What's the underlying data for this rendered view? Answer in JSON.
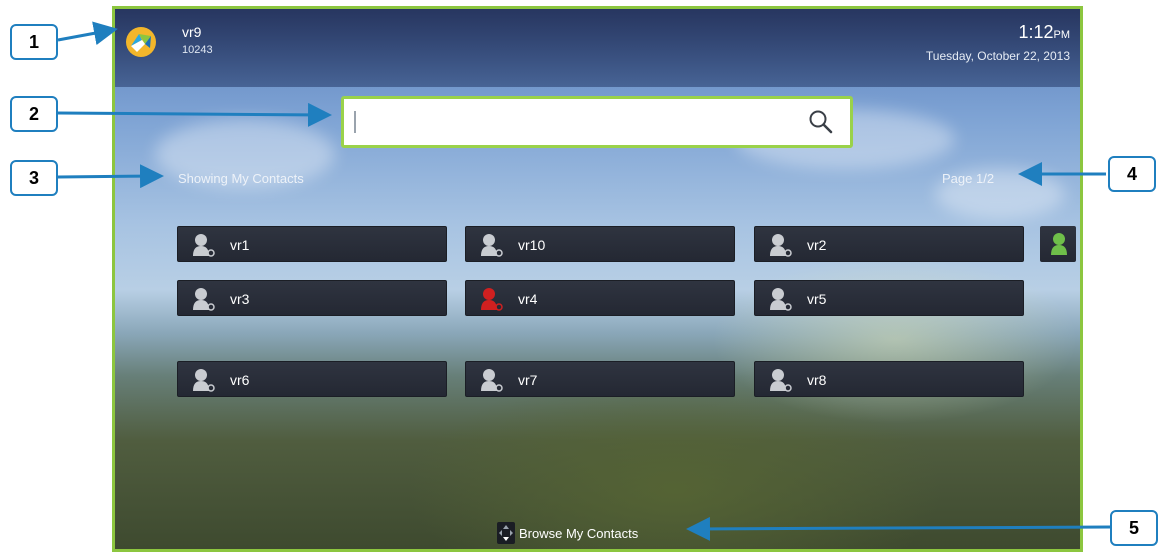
{
  "user": {
    "name": "vr9",
    "number": "10243"
  },
  "clock": {
    "time": "1:12",
    "ampm": "PM",
    "date": "Tuesday, October 22, 2013"
  },
  "search": {
    "value": "",
    "placeholder": ""
  },
  "showing_label": "Showing My Contacts",
  "page_label": "Page 1/2",
  "contacts": [
    {
      "name": "vr1",
      "status": "available"
    },
    {
      "name": "vr10",
      "status": "available"
    },
    {
      "name": "vr2",
      "status": "available"
    },
    {
      "name": "vr3",
      "status": "available"
    },
    {
      "name": "vr4",
      "status": "busy"
    },
    {
      "name": "vr5",
      "status": "available"
    },
    {
      "name": "vr6",
      "status": "available"
    },
    {
      "name": "vr7",
      "status": "available"
    },
    {
      "name": "vr8",
      "status": "available"
    }
  ],
  "browse_label": "Browse My Contacts",
  "callouts": [
    "1",
    "2",
    "3",
    "4",
    "5"
  ],
  "colors": {
    "frame": "#8cc63f",
    "search_border": "#9ad24a",
    "callout": "#1f7fbf",
    "busy": "#d02020",
    "online": "#6fbf4a"
  }
}
